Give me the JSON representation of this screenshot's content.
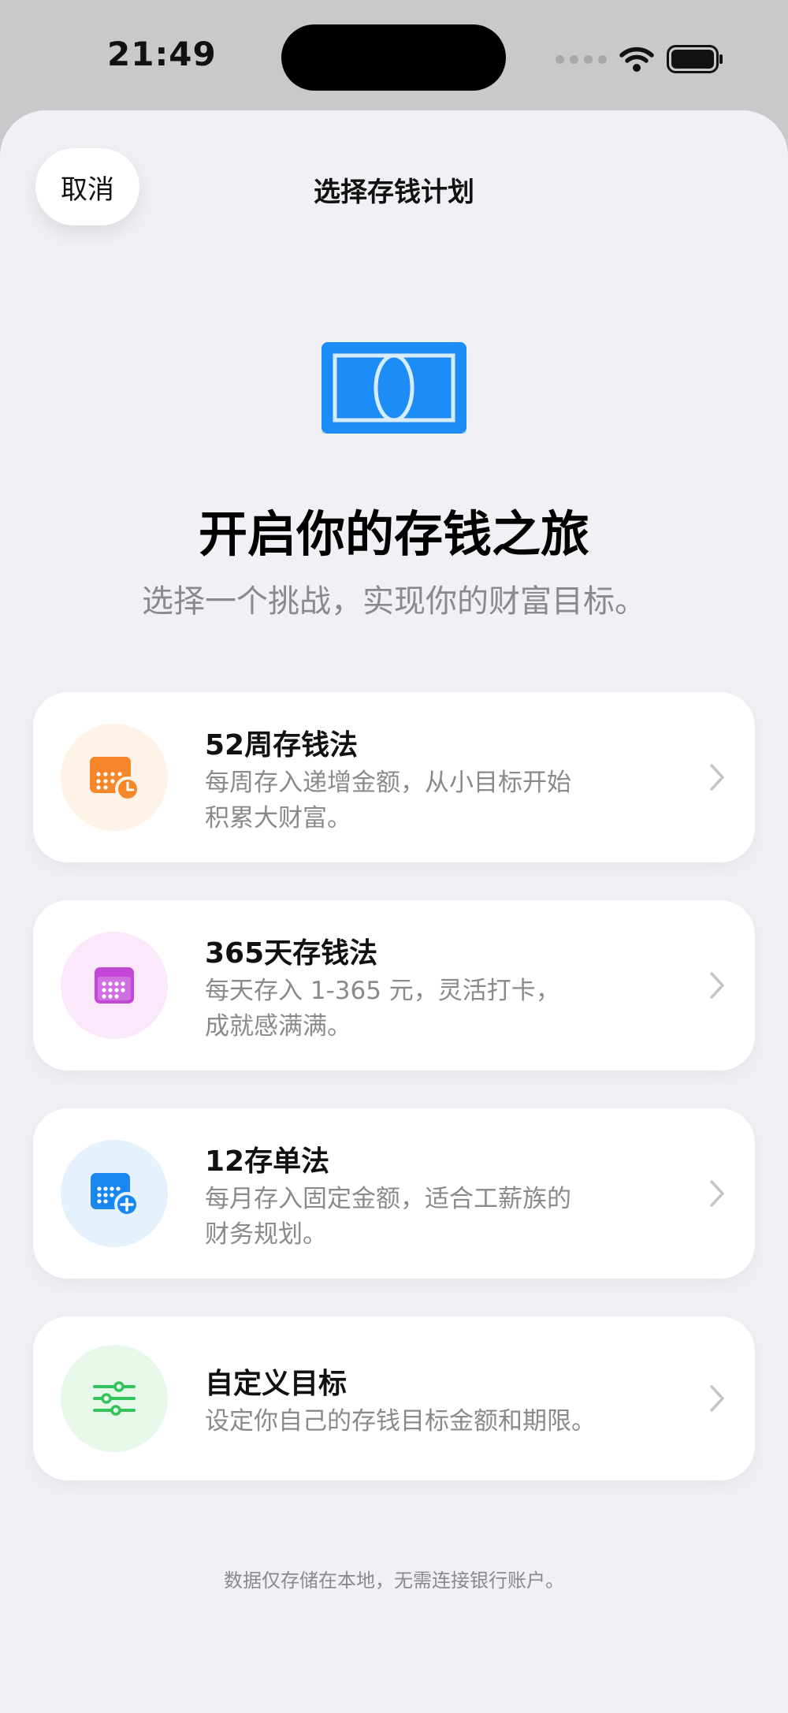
{
  "status_bar": {
    "time": "21:49"
  },
  "nav": {
    "cancel_label": "取消",
    "title": "选择存钱计划"
  },
  "hero": {
    "icon": "banknote-icon",
    "title": "开启你的存钱之旅",
    "subtitle": "选择一个挑战，实现你的财富目标。"
  },
  "plans": [
    {
      "title": "52周存钱法",
      "desc_line1": "每周存入递增金额，从小目标开始",
      "desc_line2": "积累大财富。",
      "icon": "calendar-clock-icon",
      "accent": "#f5862a",
      "bg": "#fff2e6"
    },
    {
      "title": "365天存钱法",
      "desc_line1": "每天存入 1-365 元，灵活打卡，",
      "desc_line2": "成就感满满。",
      "icon": "calendar-icon",
      "accent": "#c247d6",
      "bg": "#fbe8fb"
    },
    {
      "title": "12存单法",
      "desc_line1": "每月存入固定金额，适合工薪族的",
      "desc_line2": "财务规划。",
      "icon": "calendar-plus-icon",
      "accent": "#1a86f0",
      "bg": "#e5f2fe"
    },
    {
      "title": "自定义目标",
      "desc_line1": "设定你自己的存钱目标金额和期限。",
      "icon": "sliders-icon",
      "accent": "#32c35a",
      "bg": "#e7f8ea"
    }
  ],
  "footer": {
    "note": "数据仅存储在本地，无需连接银行账户。"
  },
  "colors": {
    "hero_blue": "#1a8cf7",
    "background": "#f0f0f5",
    "secondary_text": "#8a8a8e"
  }
}
